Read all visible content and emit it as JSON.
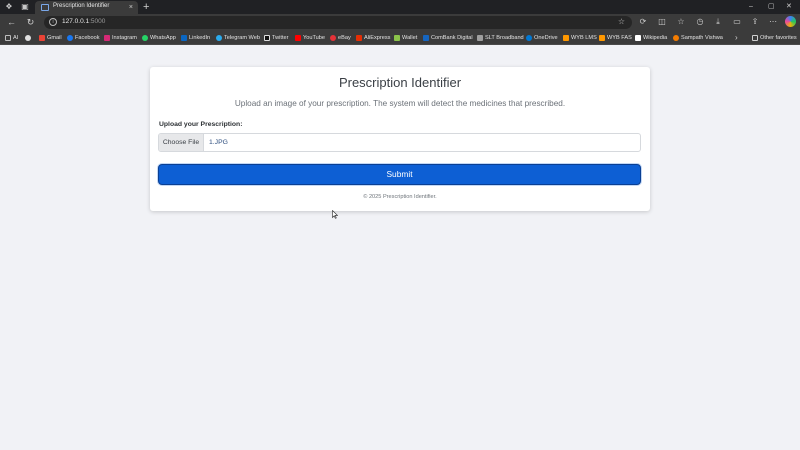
{
  "browser": {
    "tab_title": "Prescription Identifier",
    "tab_close": "×",
    "new_tab": "+",
    "url_host": "127.0.0.1",
    "url_port": ":5000",
    "window_controls": [
      "–",
      "▢",
      "✕"
    ],
    "icons": [
      "workspaces-icon",
      "tab-actions-icon",
      "back-icon",
      "refresh-icon",
      "star-icon",
      "extensions-icon",
      "split-screen-icon",
      "favorites-icon",
      "history-icon",
      "downloads-icon",
      "screenshot-icon",
      "share-icon",
      "more-icon",
      "profile-icon"
    ]
  },
  "bookmarks": [
    {
      "label": "AI",
      "color": "#bdbdbd"
    },
    {
      "label": "",
      "color": "#e0e0e0"
    },
    {
      "label": "Gmail",
      "color": "#ea4335"
    },
    {
      "label": "Facebook",
      "color": "#1877f2"
    },
    {
      "label": "Instagram",
      "color": "#d62976"
    },
    {
      "label": "WhatsApp",
      "color": "#25d366"
    },
    {
      "label": "LinkedIn",
      "color": "#0a66c2"
    },
    {
      "label": "Telegram Web",
      "color": "#2aabee"
    },
    {
      "label": "Twitter",
      "color": "#ffffff"
    },
    {
      "label": "YouTube",
      "color": "#ff0000"
    },
    {
      "label": "eBay",
      "color": "#e53238"
    },
    {
      "label": "AliExpress",
      "color": "#e62e04"
    },
    {
      "label": "Wallet",
      "color": "#8bc34a"
    },
    {
      "label": "ComBank Digital",
      "color": "#1565c0"
    },
    {
      "label": "SLT Broadband",
      "color": "#9e9e9e"
    },
    {
      "label": "OneDrive",
      "color": "#0078d4"
    },
    {
      "label": "WYB LMS",
      "color": "#ff9800"
    },
    {
      "label": "WYB FAS",
      "color": "#ff9800"
    },
    {
      "label": "Wikipedia",
      "color": "#ffffff"
    },
    {
      "label": "Sampath Vishwa",
      "color": "#f57c00"
    }
  ],
  "bookmarks_more": "›",
  "other_favorites": "Other favorites",
  "page": {
    "title": "Prescription Identifier",
    "lead": "Upload an image of your prescription. The system will detect the medicines that prescribed.",
    "upload_label": "Upload your Prescription:",
    "choose_file_label": "Choose File",
    "file_name": "1.JPG",
    "submit_label": "Submit",
    "footer": "© 2025 Prescription Identifier."
  },
  "colors": {
    "primary": "#0d5fd4",
    "page_bg": "#f1f2f6",
    "chrome_bg": "#3b3b3b"
  }
}
